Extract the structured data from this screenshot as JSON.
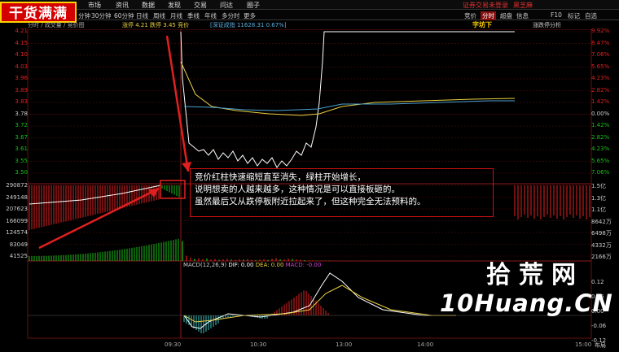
{
  "logo": {
    "text": "干货满满"
  },
  "menu": {
    "items": [
      "市场",
      "资讯",
      "数据",
      "发现",
      "交易",
      "问达",
      "圈子"
    ],
    "right_link": "证券交易未登录",
    "right_user": "黑芝麻"
  },
  "toolbar": {
    "periods": [
      "分钟",
      "30分钟",
      "60分钟",
      "日线",
      "周线",
      "月线",
      "季线",
      "年线",
      "多分时",
      "更多"
    ],
    "right_tabs": [
      "竞价",
      "分时",
      "超盘",
      "信息",
      "F10",
      "标记",
      "自选"
    ]
  },
  "infobar": {
    "left": "分时 / 成交量 / 竞价图",
    "change": "涨停 4.21 跌停 3.45 竞价",
    "index": "[深证成指 11628.31 0.67%]",
    "right_badge": "字坊下",
    "right_note": "涨跌停分析"
  },
  "price_axis": [
    "4.21",
    "4.15",
    "4.10",
    "4.03",
    "3.96",
    "3.89",
    "3.83",
    "3.78",
    "3.72",
    "3.67",
    "3.61",
    "3.55",
    "3.50"
  ],
  "pct_axis": [
    "9.92%",
    "8.47%",
    "7.06%",
    "5.65%",
    "4.23%",
    "2.82%",
    "1.42%",
    "0.00%",
    "1.42%",
    "2.82%",
    "4.23%",
    "5.65%",
    "7.06%"
  ],
  "auction_axis": [
    "290872",
    "249148",
    "207623",
    "166099",
    "124574",
    "83049",
    "41525"
  ],
  "vol_axis": [
    "1.5亿",
    "1.3亿",
    "1.1亿",
    "8642万",
    "6498万",
    "4332万",
    "2166万"
  ],
  "macd_axis": [
    "0.12",
    "0.06",
    "0.00",
    "-0.06",
    "-0.12"
  ],
  "macd_label": {
    "name": "MACD(12,26,9)",
    "dif": "DIF: 0.00",
    "dea": "DEA: 0.00",
    "macd": "MACD: -0.00"
  },
  "time_axis": [
    "09:30",
    "10:30",
    "13:00",
    "14:00",
    "15:00"
  ],
  "annotation": {
    "line1": "竞价红柱快速缩短直至消失，绿柱开始增长，",
    "line2": "说明想卖的人越来越多，这种情况是可以直接板砸的。",
    "line3": "虽然最后又从跌停板附近拉起来了，但这种完全无法预料的。"
  },
  "watermark": {
    "cn": "拾荒网",
    "en": "10Huang.CN"
  },
  "footer_right": "布局",
  "colors": {
    "up": "#e02020",
    "down": "#18c018",
    "grid": "#5a0c0c",
    "annot": "#d01010",
    "price": "#ffffff",
    "avg": "#e8d040"
  }
}
